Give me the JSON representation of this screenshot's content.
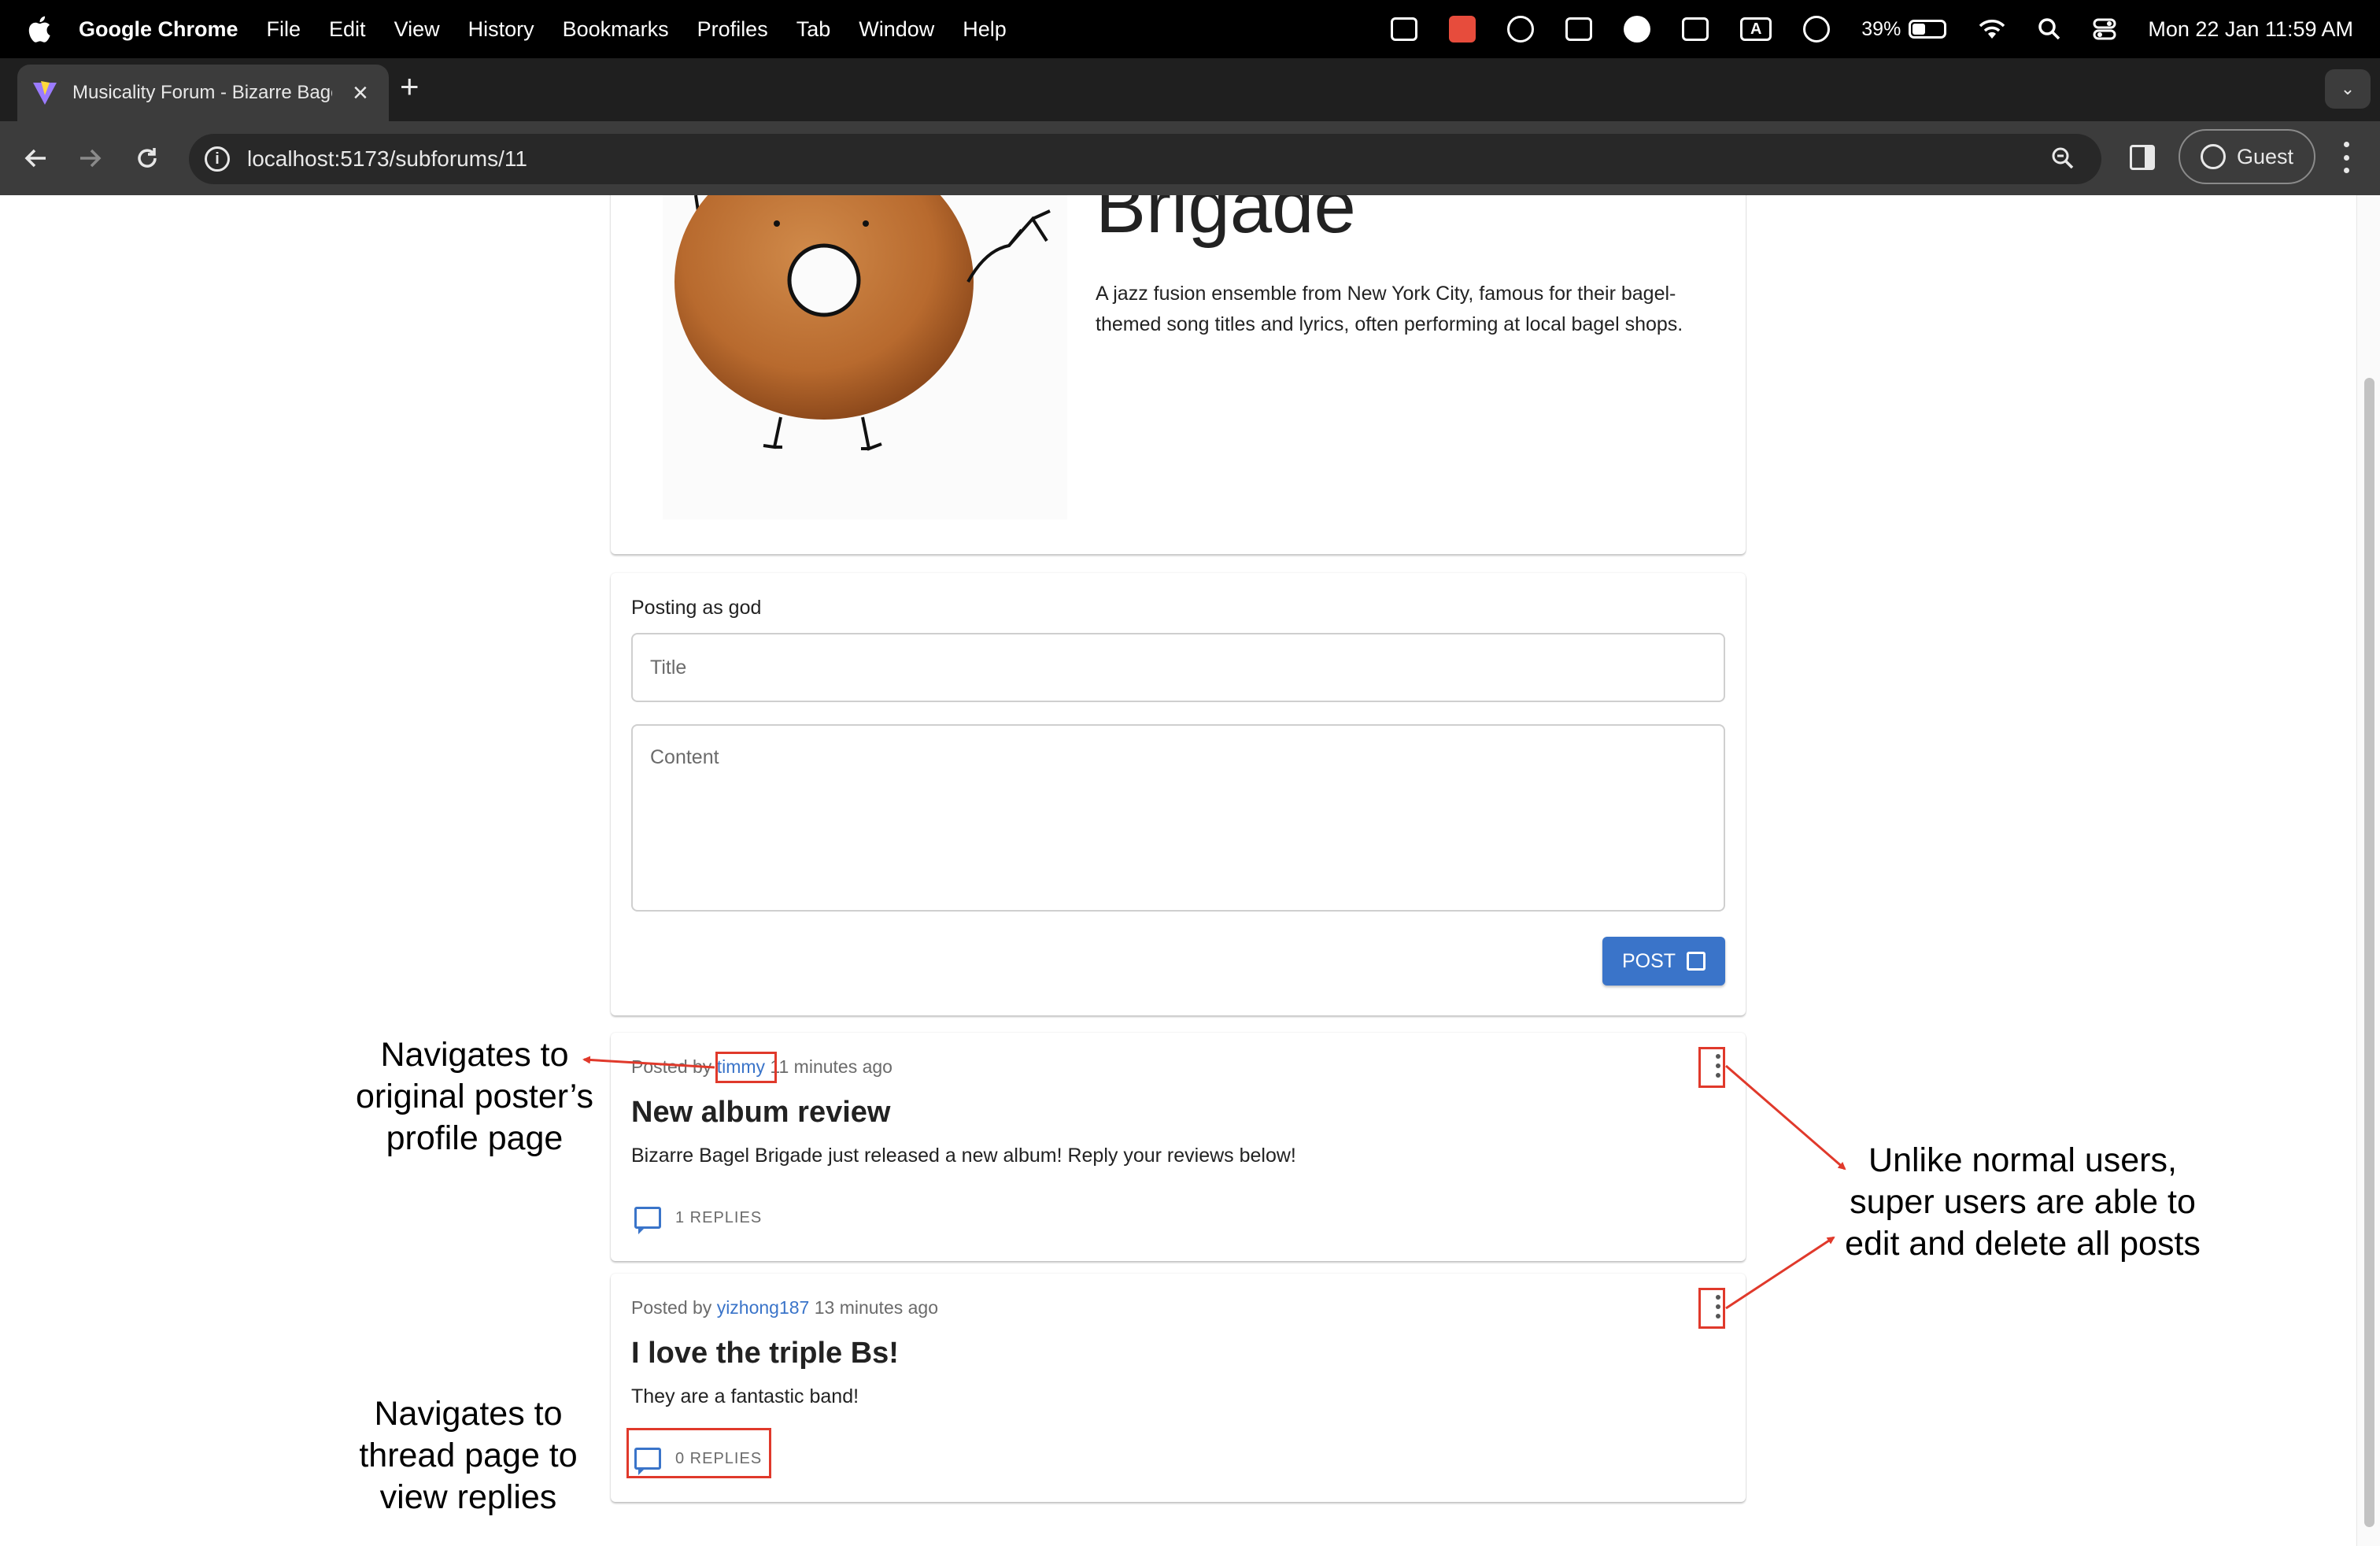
{
  "menubar": {
    "app_name": "Google Chrome",
    "items": [
      "File",
      "Edit",
      "View",
      "History",
      "Bookmarks",
      "Profiles",
      "Tab",
      "Window",
      "Help"
    ],
    "battery": "39%",
    "datetime": "Mon 22 Jan  11:59 AM",
    "tray_a": "A"
  },
  "browser": {
    "tab_title": "Musicality Forum - Bizarre Bagel Brigade",
    "url": "localhost:5173/subforums/11",
    "profile_label": "Guest"
  },
  "band": {
    "name_visible": "Brigade",
    "description": "A jazz fusion ensemble from New York City, famous for their bagel-themed song titles and lyrics, often performing at local bagel shops."
  },
  "composer": {
    "posting_as": "Posting as god",
    "title_placeholder": "Title",
    "content_placeholder": "Content",
    "post_label": "POST"
  },
  "threads": [
    {
      "posted_by_prefix": "Posted by",
      "author": "timmy",
      "time": "11 minutes ago",
      "title": "New album review",
      "body": "Bizarre Bagel Brigade just released a new album! Reply your reviews below!",
      "replies_label": "1 REPLIES"
    },
    {
      "posted_by_prefix": "Posted by",
      "author": "yizhong187",
      "time": "13 minutes ago",
      "title": "I love the triple Bs!",
      "body": "They are a fantastic band!",
      "replies_label": "0 REPLIES"
    }
  ],
  "annotations": {
    "profile_note": [
      "Navigates to",
      "original poster’s",
      "profile page"
    ],
    "thread_note": [
      "Navigates to",
      "thread page to",
      "view replies"
    ],
    "superuser_note": [
      "Unlike normal users,",
      "super users are able to",
      "edit and delete all posts"
    ]
  },
  "colors": {
    "accent": "#3a74c9",
    "annotation": "#e0392b",
    "menubar": "#000000",
    "toolbar": "#3c3c3c"
  }
}
